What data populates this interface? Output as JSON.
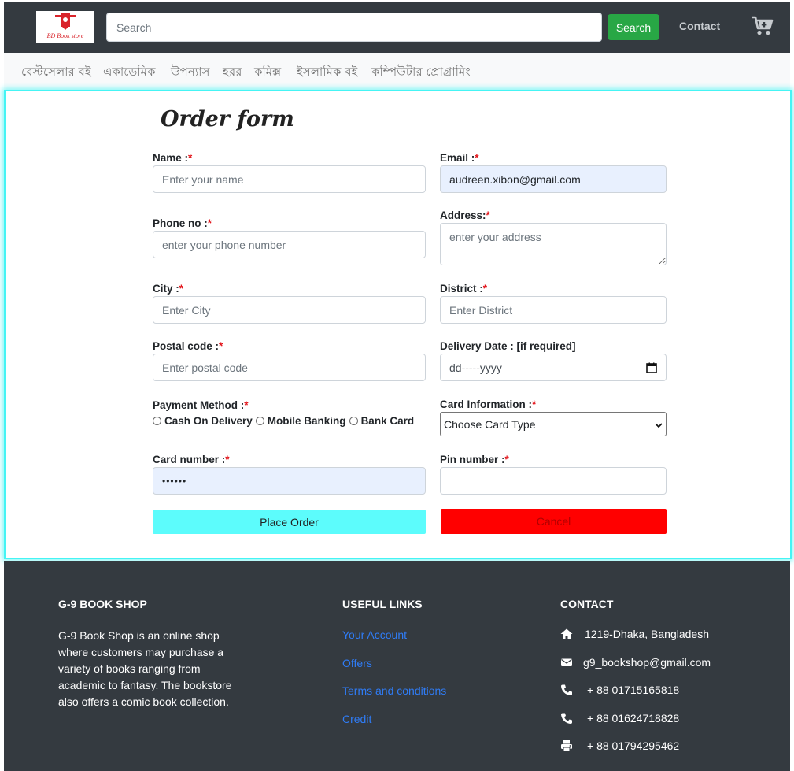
{
  "header": {
    "logo_text": "BD Book store",
    "search_placeholder": "Search",
    "search_button": "Search",
    "contact_link": "Contact"
  },
  "categories": [
    "বেস্টসেলার বই",
    "একাডেমিক",
    "উপন্যাস",
    "হরর",
    "কমিক্স",
    "ইসলামিক বই",
    "কম্পিউটার প্রোগ্রামিং"
  ],
  "form": {
    "title": "Order form",
    "required_mark": "*",
    "name": {
      "label": "Name :",
      "placeholder": "Enter your name"
    },
    "email": {
      "label": "Email :",
      "value": "audreen.xibon@gmail.com"
    },
    "phone": {
      "label": "Phone no :",
      "placeholder": "enter your phone number"
    },
    "address": {
      "label": "Address:",
      "placeholder": "enter your address"
    },
    "city": {
      "label": "City :",
      "placeholder": "Enter City"
    },
    "district": {
      "label": "District :",
      "placeholder": "Enter District"
    },
    "postal": {
      "label": "Postal code :",
      "placeholder": "Enter postal code"
    },
    "delivery_date": {
      "label": "Delivery Date : [if required]",
      "placeholder": "dd-----yyyy"
    },
    "payment": {
      "label": "Payment Method :",
      "options": [
        "Cash On Delivery",
        "Mobile Banking",
        "Bank Card"
      ]
    },
    "card_info": {
      "label": "Card Information :",
      "selected": "Choose Card Type"
    },
    "card_number": {
      "label": "Card number :",
      "value": "••••••"
    },
    "pin": {
      "label": "Pin number :"
    },
    "place_order": "Place Order",
    "cancel": "Cancel"
  },
  "footer": {
    "shop_title": "G-9 BOOK SHOP",
    "shop_about": "G-9 Book Shop is an online shop where customers may purchase a variety of books ranging from academic to fantasy. The bookstore also offers a comic book collection.",
    "links_title": "USEFUL LINKS",
    "links": [
      "Your Account",
      "Offers",
      "Terms and conditions",
      "Credit"
    ],
    "contact_title": "CONTACT",
    "contacts": [
      {
        "icon": "home-icon",
        "text": "1219-Dhaka, Bangladesh"
      },
      {
        "icon": "envelope-icon",
        "text": "g9_bookshop@gmail.com"
      },
      {
        "icon": "phone-icon",
        "text": "+ 88 01715165818"
      },
      {
        "icon": "phone-icon",
        "text": "+ 88 01624718828"
      },
      {
        "icon": "printer-icon",
        "text": "+ 88 01794295462"
      }
    ]
  },
  "colors": {
    "navbar": "#343a40",
    "search_button": "#28a745",
    "place_order": "#5cfcfc",
    "cancel": "#ff0000",
    "link": "#2f7cf6",
    "required": "#e3161c",
    "card_glow": "#45f4f4"
  }
}
